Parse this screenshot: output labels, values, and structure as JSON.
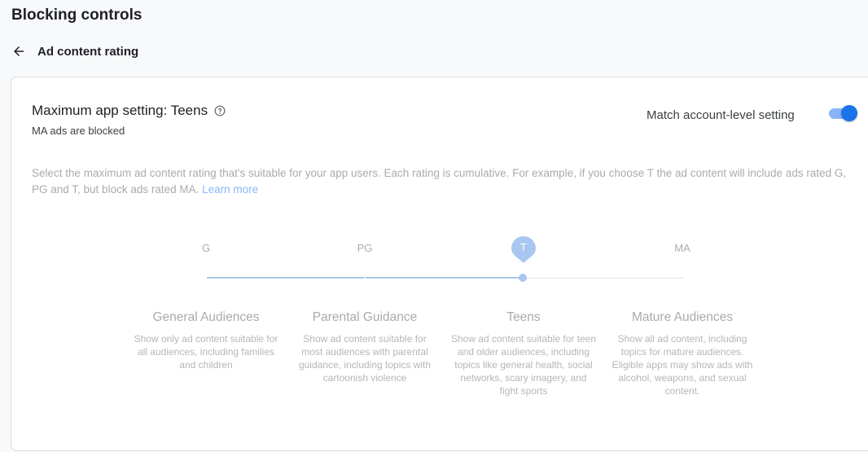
{
  "header": {
    "page_title": "Blocking controls",
    "back_title": "Ad content rating"
  },
  "setting": {
    "title": "Maximum app setting: Teens",
    "subtitle": "MA ads are blocked",
    "match_label": "Match account-level setting",
    "match_enabled": true,
    "description": "Select the maximum ad content rating that's suitable for your app users. Each rating is cumulative. For example, if you choose T the ad content will include ads rated G, PG and T, but block ads rated MA.",
    "learn_more": "Learn more"
  },
  "slider": {
    "labels": [
      "G",
      "PG",
      "T",
      "MA"
    ],
    "selected_index": 2,
    "selected_label": "T"
  },
  "options": [
    {
      "title": "General Audiences",
      "description": "Show only ad content suitable for all audiences, including families and children"
    },
    {
      "title": "Parental Guidance",
      "description": "Show ad content suitable for most audiences with parental guidance, including topics with cartoonish violence"
    },
    {
      "title": "Teens",
      "description": "Show ad content suitable for teen and older audiences, including topics like general health, social networks, scary imagery, and fight sports"
    },
    {
      "title": "Mature Audiences",
      "description": "Show all ad content, including topics for mature audiences. Eligible apps may show ads with alcohol, weapons, and sexual content."
    }
  ],
  "colors": {
    "accent": "#1a73e8",
    "accent_light": "#8ab4f8",
    "muted_text": "#a9abae"
  },
  "icons": {
    "back": "arrow-back-icon",
    "help": "help-circle-icon"
  }
}
